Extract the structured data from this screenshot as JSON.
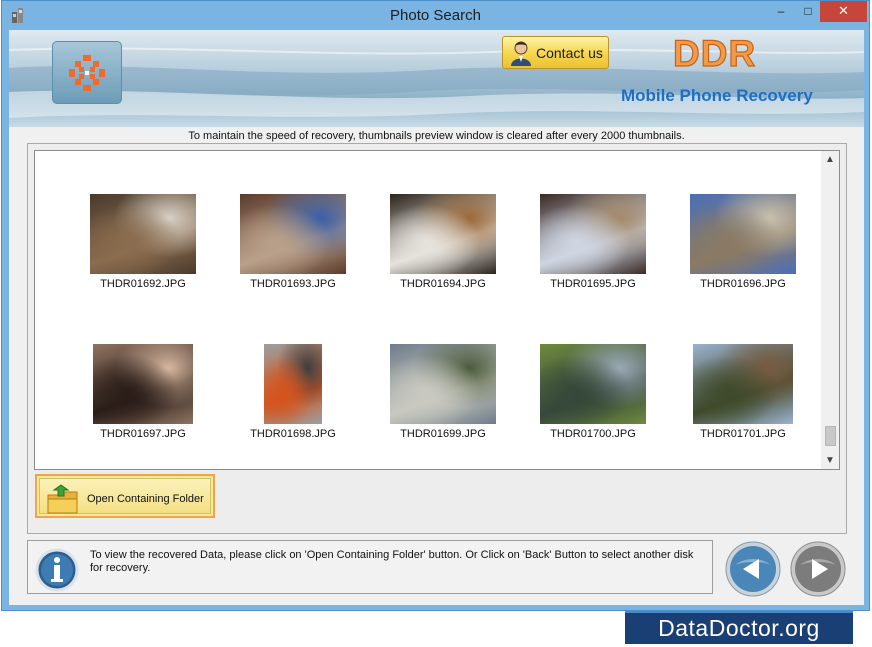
{
  "window": {
    "title": "Photo Search",
    "controls": {
      "minimize": "–",
      "maximize": "□",
      "close": "✕"
    }
  },
  "banner": {
    "contact_label": "Contact us",
    "brand": "DDR",
    "product": "Mobile Phone Recovery"
  },
  "notice": "To maintain the speed of recovery, thumbnails preview window is cleared after every 2000 thumbnails.",
  "thumbnails": [
    {
      "name": "THDR01692.JPG",
      "colors": [
        "#4a3a2c",
        "#8a6c4e",
        "#d6d0c6"
      ]
    },
    {
      "name": "THDR01693.JPG",
      "colors": [
        "#5b3a2a",
        "#b9a08a",
        "#3a5fa8"
      ]
    },
    {
      "name": "THDR01694.JPG",
      "colors": [
        "#2b241d",
        "#e6e2dc",
        "#9b6a3a"
      ]
    },
    {
      "name": "THDR01695.JPG",
      "colors": [
        "#3a2a26",
        "#cfd6e2",
        "#a58a6a"
      ]
    },
    {
      "name": "THDR01696.JPG",
      "colors": [
        "#4a6fb8",
        "#8b7a64",
        "#c9c0ad"
      ]
    },
    {
      "name": "THDR01697.JPG",
      "colors": [
        "#8f7463",
        "#2a1d18",
        "#d9b8a0"
      ]
    },
    {
      "name": "THDR01698.JPG",
      "colors": [
        "#9aa0a0",
        "#d4541e",
        "#3e3e3e"
      ]
    },
    {
      "name": "THDR01699.JPG",
      "colors": [
        "#6e7c8a",
        "#c9c9c0",
        "#4d5c3c"
      ]
    },
    {
      "name": "THDR01700.JPG",
      "colors": [
        "#6f8a3e",
        "#35483a",
        "#9aa9b8"
      ]
    },
    {
      "name": "THDR01701.JPG",
      "colors": [
        "#9db2cf",
        "#3f4a2a",
        "#7a5a40"
      ]
    }
  ],
  "scroll": {
    "up": "▲",
    "down": "▼"
  },
  "open_folder_label": "Open Containing Folder",
  "status_text": "To view the recovered Data, please click on 'Open Containing Folder' button. Or Click on 'Back' Button to select another disk for recovery.",
  "watermark": "DataDoctor.org",
  "colors": {
    "accent_yellow": "#f3df82",
    "brand_orange": "#f29b47",
    "product_blue": "#1d6fc6",
    "close_red": "#c7463c"
  },
  "icons": [
    "app-icon",
    "logo-icon",
    "user-avatar-icon",
    "folder-up-icon",
    "info-icon",
    "back-arrow-icon",
    "next-arrow-icon"
  ]
}
